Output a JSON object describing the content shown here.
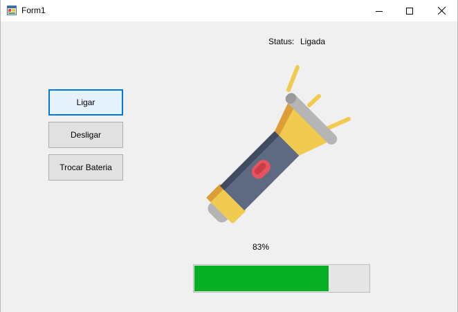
{
  "window": {
    "title": "Form1",
    "icon": "winforms-app-icon",
    "controls": [
      "minimize-icon",
      "maximize-icon",
      "close-icon"
    ]
  },
  "buttons": {
    "ligar": "Ligar",
    "desligar": "Desligar",
    "trocar_bateria": "Trocar Bateria"
  },
  "status": {
    "label": "Status:",
    "value": "Ligada"
  },
  "flashlight": {
    "icon": "flashlight-icon",
    "state": "on"
  },
  "battery": {
    "percent_text": "83%",
    "progress": 0.77,
    "fill_color": "#06b025"
  },
  "colors": {
    "focus_border": "#0078d7",
    "progress_fill": "#06b025",
    "beam": "#f1cb4f"
  }
}
